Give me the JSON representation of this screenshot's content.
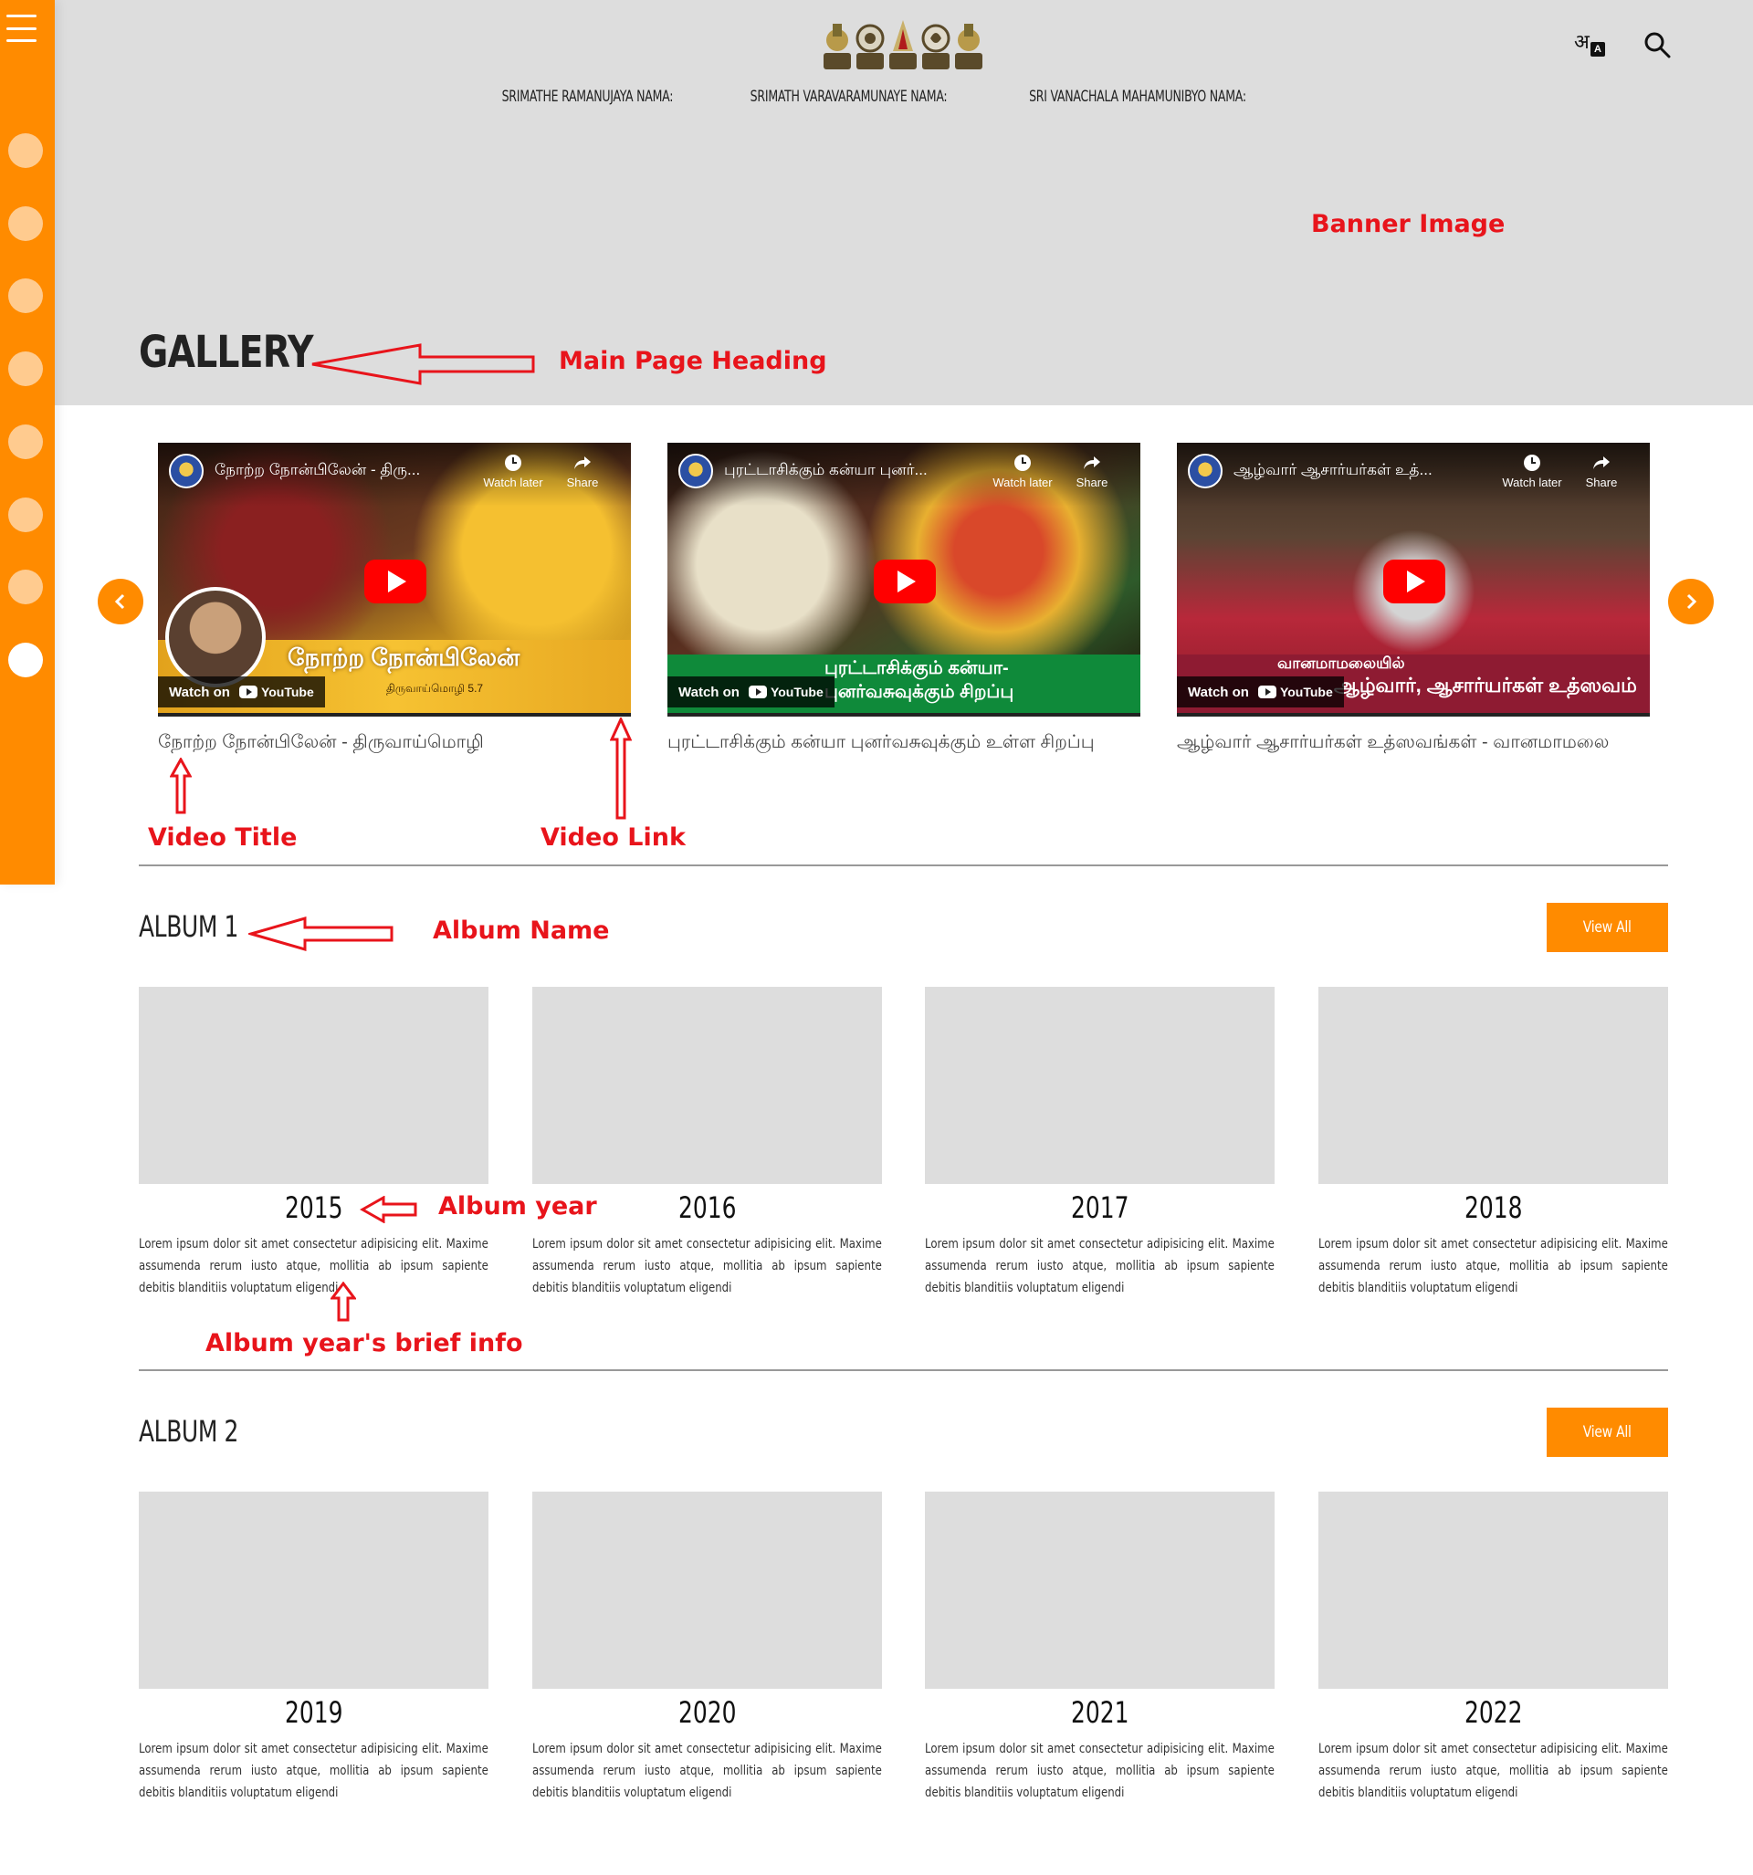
{
  "nav": {
    "items": [
      "SRIMATHE RAMANUJAYA NAMA:",
      "SRIMATH VARAVARAMUNAYE NAMA:",
      "SRI VANACHALA MAHAMUNIBYO NAMA:"
    ]
  },
  "header": {
    "translate_glyph": "अ",
    "translate_badge": "A"
  },
  "page": {
    "title": "GALLERY"
  },
  "annotations": {
    "banner": "Banner Image",
    "main_heading": "Main Page Heading",
    "video_title": "Video Title",
    "video_link": "Video Link",
    "album_name": "Album Name",
    "album_year": "Album year",
    "album_info": "Album year's brief info"
  },
  "videos": [
    {
      "yt_title": "நோற்ற நோன்பிலேன் - திரு...",
      "overlay": "நோற்ற நோன்பிலேன்",
      "overlay_sub": "திருவாய்மொழி 5.7",
      "caption": "நோற்ற நோன்பிலேன் - திருவாய்மொழி"
    },
    {
      "yt_title": "புரட்டாசிக்கும் கன்யா புனர்...",
      "overlay": "புரட்டாசிக்கும் கன்யா-புனர்வசுவுக்கும் சிறப்பு",
      "caption": "புரட்டாசிக்கும் கன்யா புனர்வசுவுக்கும் உள்ள சிறப்பு"
    },
    {
      "yt_title": "ஆழ்வார் ஆசார்யர்கள் உத்...",
      "overlay_sub": "வானமாமலையில்",
      "overlay": "ஆழ்வார், ஆசார்யர்கள் உத்ஸவம்",
      "caption": "ஆழ்வார் ஆசார்யர்கள் உத்ஸவங்கள் - வானமாமலை"
    }
  ],
  "yt_labels": {
    "watch_later": "Watch later",
    "share": "Share",
    "watch_on": "Watch on",
    "youtube": "YouTube"
  },
  "albums": [
    {
      "name": "ALBUM 1",
      "view_all": "View All",
      "years": [
        {
          "year": "2015",
          "desc": "Lorem ipsum dolor sit amet consectetur adipisicing elit. Maxime assumenda rerum iusto atque, mollitia ab ipsum sapiente debitis blanditiis voluptatum eligendi"
        },
        {
          "year": "2016",
          "desc": "Lorem ipsum dolor sit amet consectetur adipisicing elit. Maxime assumenda rerum iusto atque, mollitia ab ipsum sapiente debitis blanditiis voluptatum eligendi"
        },
        {
          "year": "2017",
          "desc": "Lorem ipsum dolor sit amet consectetur adipisicing elit. Maxime assumenda rerum iusto atque, mollitia ab ipsum sapiente debitis blanditiis voluptatum eligendi"
        },
        {
          "year": "2018",
          "desc": "Lorem ipsum dolor sit amet consectetur adipisicing elit. Maxime assumenda rerum iusto atque, mollitia ab ipsum sapiente debitis blanditiis voluptatum eligendi"
        }
      ]
    },
    {
      "name": "ALBUM 2",
      "view_all": "View All",
      "years": [
        {
          "year": "2019",
          "desc": "Lorem ipsum dolor sit amet consectetur adipisicing elit. Maxime assumenda rerum iusto atque, mollitia ab ipsum sapiente debitis blanditiis voluptatum eligendi"
        },
        {
          "year": "2020",
          "desc": "Lorem ipsum dolor sit amet consectetur adipisicing elit. Maxime assumenda rerum iusto atque, mollitia ab ipsum sapiente debitis blanditiis voluptatum eligendi"
        },
        {
          "year": "2021",
          "desc": "Lorem ipsum dolor sit amet consectetur adipisicing elit. Maxime assumenda rerum iusto atque, mollitia ab ipsum sapiente debitis blanditiis voluptatum eligendi"
        },
        {
          "year": "2022",
          "desc": "Lorem ipsum dolor sit amet consectetur adipisicing elit. Maxime assumenda rerum iusto atque, mollitia ab ipsum sapiente debitis blanditiis voluptatum eligendi"
        }
      ]
    }
  ],
  "icons": {
    "menu": "hamburger-menu-icon",
    "translate": "translate-icon",
    "search": "search-icon",
    "prev": "chevron-left-icon",
    "next": "chevron-right-icon"
  },
  "colors": {
    "accent": "#ff8b00",
    "banner_bg": "#dddddd",
    "annotation": "#e8141b",
    "youtube_red": "#ff0000"
  }
}
